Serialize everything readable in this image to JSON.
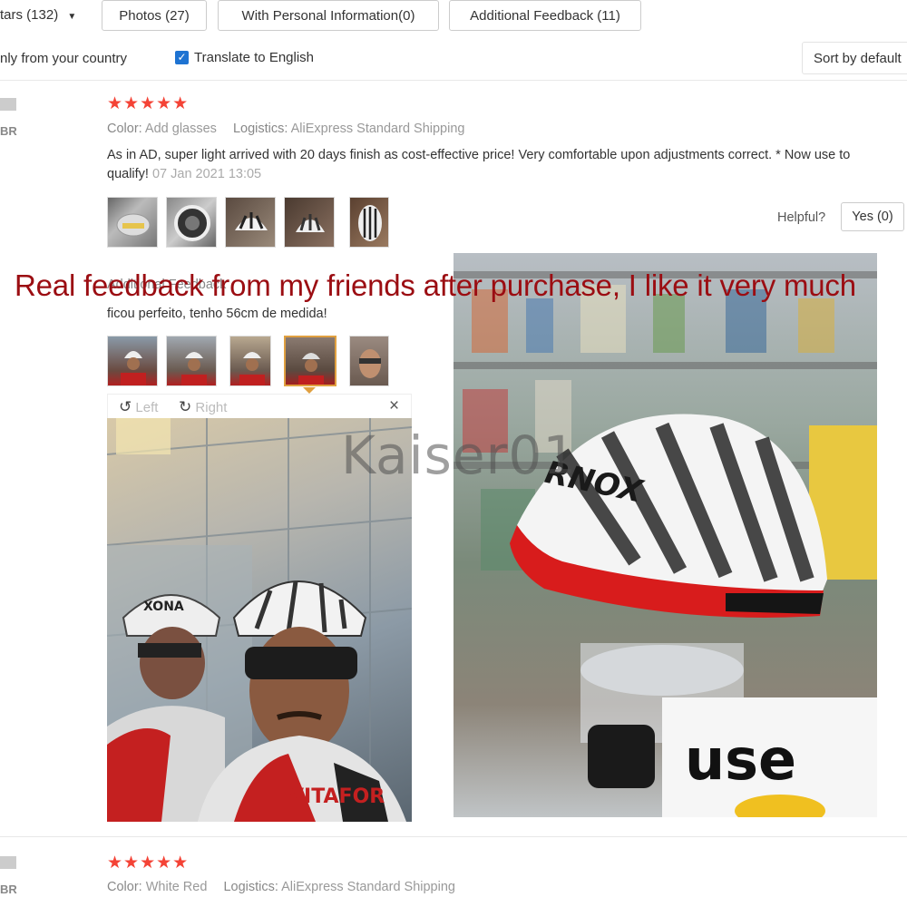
{
  "filters": {
    "stars_label": "tars (132)",
    "photos_label": "Photos (27)",
    "personal_label": "With Personal Information(0)",
    "additional_label": "Additional Feedback (11)",
    "only_country_label": "nly from your country",
    "translate_label": "Translate to English",
    "translate_checked": true,
    "sort_label": "Sort by default"
  },
  "reviews": [
    {
      "user_abbr": "BR",
      "stars": "★★★★★",
      "color_key": "Color:",
      "color_value": "Add glasses",
      "logistics_key": "Logistics:",
      "logistics_value": "AliExpress Standard Shipping",
      "text": "As in AD, super light arrived with 20 days finish as cost-effective price! Very comfortable upon adjustments correct. * Now use to qualify!",
      "date": "07 Jan 2021 13:05",
      "helpful_label": "Helpful?",
      "yes_label": "Yes (0)",
      "additional_feedback_label": "Additional Feedback",
      "additional_feedback_text": "ficou perfeito, tenho 56cm de medida!"
    },
    {
      "user_abbr": "BR",
      "stars": "★★★★★",
      "color_key": "Color:",
      "color_value": "White Red",
      "logistics_key": "Logistics:",
      "logistics_value": "AliExpress Standard Shipping"
    }
  ],
  "viewer": {
    "left_label": "Left",
    "right_label": "Right",
    "close_symbol": "×"
  },
  "overlay": {
    "caption": "Real feedback from my friends after purchase, I like it very much",
    "watermark": "Kaiser01"
  },
  "helmet_logo": "RNOX",
  "side_helmet_logo": "XONA",
  "jersey_text": "VITAFOR",
  "store_sign": "use"
}
